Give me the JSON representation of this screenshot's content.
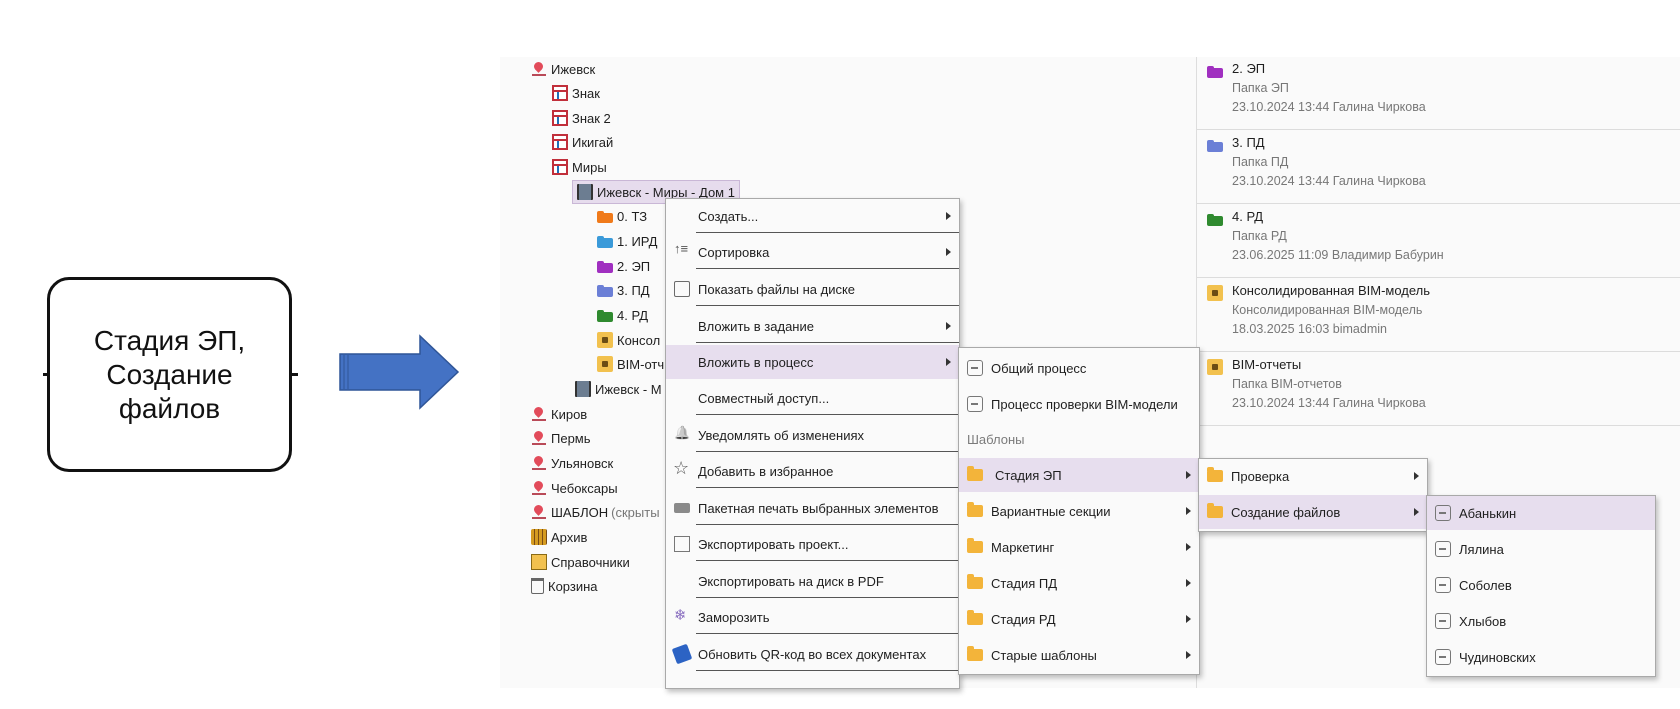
{
  "callout": {
    "lines": [
      "Стадия ЭП,",
      "Создание",
      "файлов"
    ]
  },
  "colors": {
    "arrow": "#4472c4",
    "highlight": "#e7deee",
    "menu_bg": "#fafafa"
  },
  "tree": [
    {
      "label": "Ижевск",
      "icon": "location-pin-icon"
    },
    {
      "label": "Знак",
      "icon": "table-icon"
    },
    {
      "label": "Знак 2",
      "icon": "table-icon"
    },
    {
      "label": "Икигай",
      "icon": "table-icon"
    },
    {
      "label": "Миры",
      "icon": "table-icon"
    },
    {
      "label": "Ижевск - Миры - Дом 1",
      "icon": "building-icon"
    },
    {
      "label": "0. ТЗ",
      "icon": "folder-icon",
      "color": "#f07a1a"
    },
    {
      "label": "1. ИРД",
      "icon": "folder-icon",
      "color": "#3a9ad9"
    },
    {
      "label": "2. ЭП",
      "icon": "folder-icon",
      "color": "#a02fc0"
    },
    {
      "label": "3. ПД",
      "icon": "folder-icon",
      "color": "#6b7fd6"
    },
    {
      "label": "4. РД",
      "icon": "folder-icon",
      "color": "#2f8a2f"
    },
    {
      "label": "Консол",
      "icon": "locked-folder-icon"
    },
    {
      "label": "BIM-отч",
      "icon": "locked-folder-icon"
    },
    {
      "label": "Ижевск - М",
      "icon": "buildings-icon"
    },
    {
      "label": "Киров",
      "icon": "location-pin-icon"
    },
    {
      "label": "Пермь",
      "icon": "location-pin-icon"
    },
    {
      "label": "Ульяновск",
      "icon": "location-pin-icon"
    },
    {
      "label": "Чебоксары",
      "icon": "location-pin-icon"
    },
    {
      "label": "ШАБЛОН",
      "muted": "(скрыты",
      "icon": "location-pin-icon"
    },
    {
      "label": "Архив",
      "icon": "archive-icon"
    },
    {
      "label": "Справочники",
      "icon": "book-icon"
    },
    {
      "label": "Корзина",
      "icon": "trash-icon"
    }
  ],
  "cards": [
    {
      "title": "2. ЭП",
      "subtitle": "Папка ЭП",
      "meta": "23.10.2024 13:44 Галина Чиркова",
      "color": "#a02fc0"
    },
    {
      "title": "3. ПД",
      "subtitle": "Папка ПД",
      "meta": "23.10.2024 13:44 Галина Чиркова",
      "color": "#6b7fd6"
    },
    {
      "title": "4. РД",
      "subtitle": "Папка РД",
      "meta": "23.06.2025 11:09 Владимир Бабурин",
      "color": "#2f8a2f"
    },
    {
      "title": "Консолидированная BIM-модель",
      "subtitle": "Консолидированная BIM-модель",
      "meta": "18.03.2025 16:03 bimadmin",
      "color": "#f2c14e"
    },
    {
      "title": "BIM-отчеты",
      "subtitle": "Папка BIM-отчетов",
      "meta": "23.10.2024 13:44 Галина Чиркова",
      "color": "#f2c14e"
    }
  ],
  "menu_main": [
    {
      "label": "Создать...",
      "submenu": true,
      "icon": ""
    },
    {
      "label": "Сортировка",
      "submenu": true,
      "icon": "sort-icon"
    },
    {
      "label": "Показать файлы на диске",
      "submenu": false,
      "icon": "disk-icon"
    },
    {
      "label": "Вложить в задание",
      "submenu": true,
      "icon": ""
    },
    {
      "label": "Вложить в процесс",
      "submenu": true,
      "icon": "",
      "highlight": true
    },
    {
      "label": "Совместный доступ...",
      "submenu": false,
      "icon": ""
    },
    {
      "label": "Уведомлять об изменениях",
      "submenu": false,
      "icon": "bell-icon"
    },
    {
      "label": "Добавить в избранное",
      "submenu": false,
      "icon": "star-icon"
    },
    {
      "label": "Пакетная печать выбранных элементов",
      "submenu": false,
      "icon": "printer-icon"
    },
    {
      "label": "Экспортировать проект...",
      "submenu": false,
      "icon": "export-icon"
    },
    {
      "label": "Экспортировать на диск в PDF",
      "submenu": false,
      "icon": ""
    },
    {
      "label": "Заморозить",
      "submenu": false,
      "icon": "snowflake-icon"
    },
    {
      "label": "Обновить QR-код во всех документах",
      "submenu": false,
      "icon": "qr-brush-icon"
    }
  ],
  "menu_process": [
    {
      "label": "Общий процесс",
      "icon": "process-icon"
    },
    {
      "label": "Процесс проверки BIM-модели",
      "icon": "process-icon"
    },
    {
      "label": "Шаблоны",
      "header": true
    },
    {
      "label": "Стадия ЭП",
      "icon": "folder-icon",
      "submenu": true,
      "highlight": true
    },
    {
      "label": "Вариантные секции",
      "icon": "folder-icon",
      "submenu": true
    },
    {
      "label": "Маркетинг",
      "icon": "folder-icon",
      "submenu": true
    },
    {
      "label": "Стадия ПД",
      "icon": "folder-icon",
      "submenu": true
    },
    {
      "label": "Стадия РД",
      "icon": "folder-icon",
      "submenu": true
    },
    {
      "label": "Старые шаблоны",
      "icon": "folder-icon",
      "submenu": true
    }
  ],
  "menu_stage": [
    {
      "label": "Проверка",
      "icon": "folder-icon",
      "submenu": true
    },
    {
      "label": "Создание файлов",
      "icon": "folder-icon",
      "submenu": true,
      "highlight": true
    }
  ],
  "menu_people": [
    {
      "label": "Абанькин",
      "icon": "process-icon",
      "highlight": true
    },
    {
      "label": "Лялина",
      "icon": "process-icon"
    },
    {
      "label": "Соболев",
      "icon": "process-icon"
    },
    {
      "label": "Хлыбов",
      "icon": "process-icon"
    },
    {
      "label": "Чудиновских",
      "icon": "process-icon"
    }
  ]
}
